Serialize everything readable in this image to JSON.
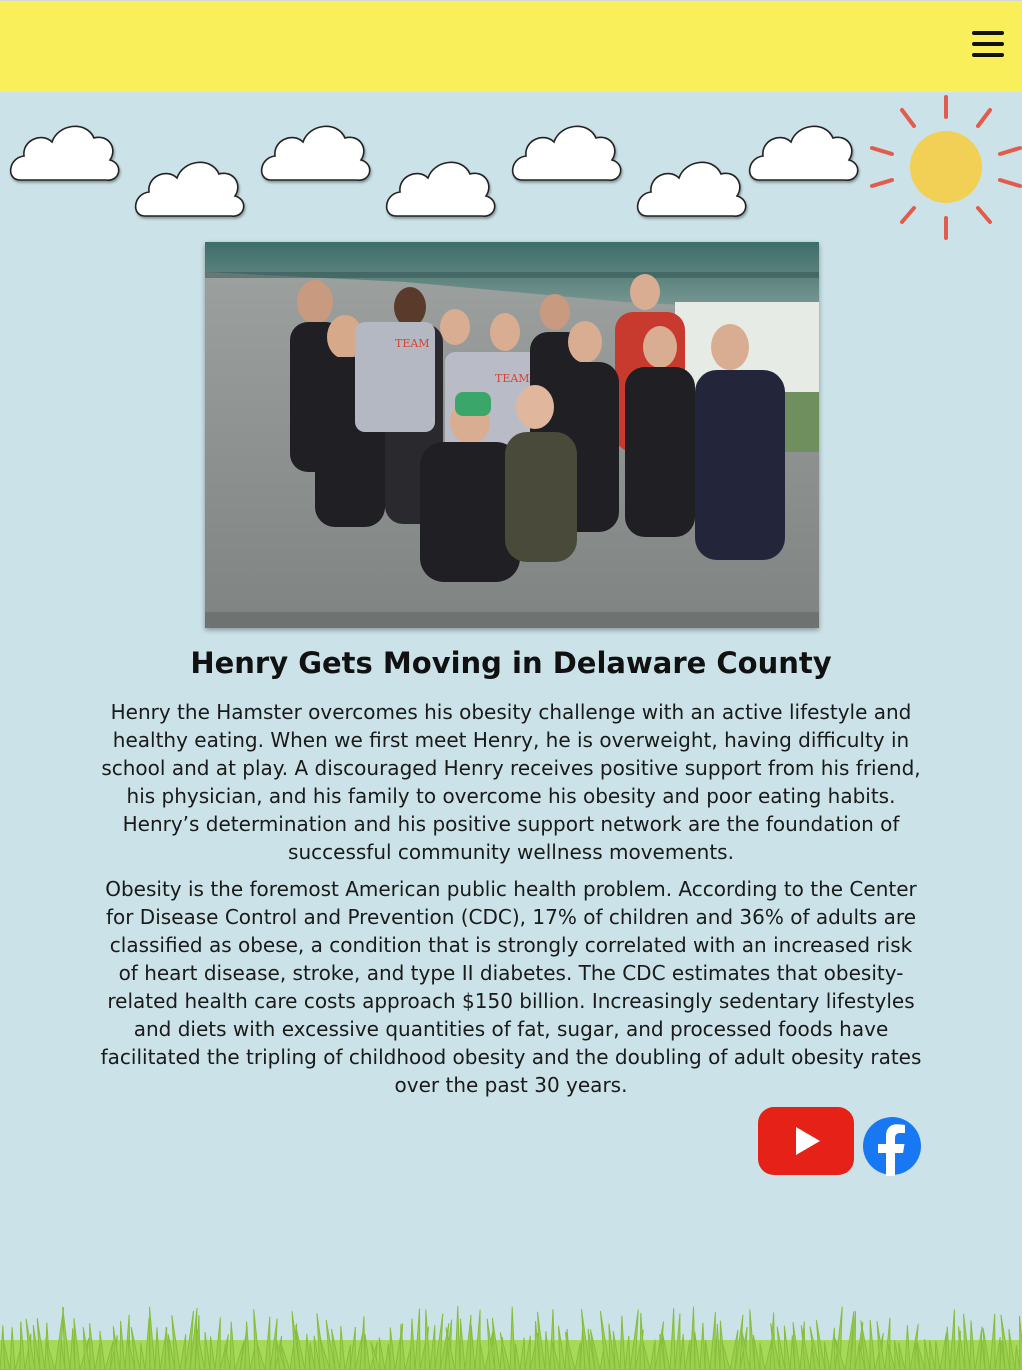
{
  "header": {
    "menu_icon": "hamburger-menu-icon",
    "background_color": "#f9ef5a"
  },
  "decor": {
    "sky_color": "#cbe3e8",
    "sun_color": "#f2cf55",
    "sun_ray_color": "#e35b4d",
    "cloud_icon": "cloud-icon",
    "grass_color": "#a6d957"
  },
  "article": {
    "photo_alt": "Group photo of Team Henry volunteers",
    "title": "Henry Gets Moving in Delaware County",
    "paragraphs": [
      "Henry the Hamster overcomes his obesity challenge with an active lifestyle and healthy eating. When we first meet Henry, he is overweight, having difficulty in school and at play. A discouraged Henry receives positive support from his friend, his physician, and his family to overcome his obesity and poor eating habits. Henry’s determination and his positive support network are the foundation of successful community wellness movements.",
      "Obesity is the foremost American public health problem. According to the Center for Disease Control and Prevention (CDC), 17% of children and 36% of adults are classified as obese, a condition that is strongly correlated with an increased risk of heart disease, stroke, and type II diabetes. The CDC estimates that obesity-related health care costs approach $150 billion. Increasingly sedentary lifestyles and diets with excessive quantities of fat, sugar, and processed foods have facilitated the tripling of childhood obesity and the doubling of adult obesity rates over the past 30 years."
    ]
  },
  "social": {
    "youtube_icon": "youtube-icon",
    "youtube_color": "#e62117",
    "facebook_icon": "facebook-icon",
    "facebook_color": "#1877f2"
  }
}
